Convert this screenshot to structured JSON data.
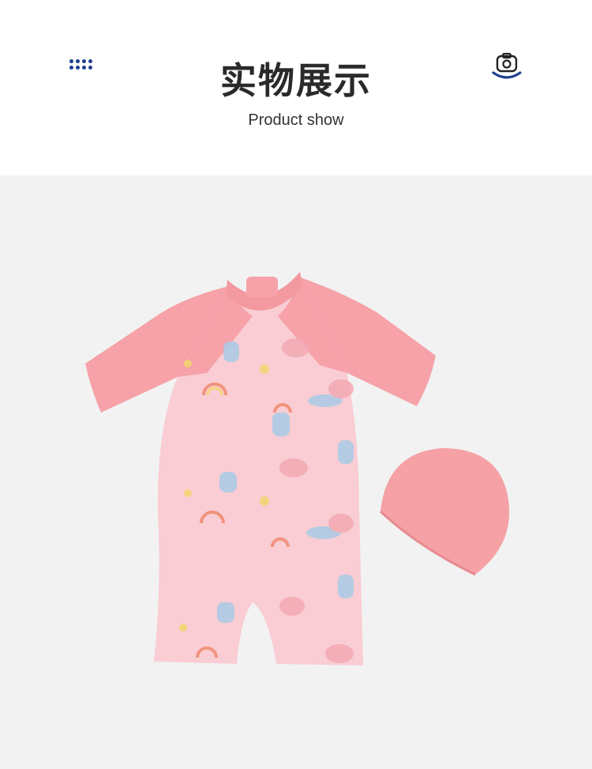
{
  "header": {
    "title": "实物展示",
    "subtitle": "Product show",
    "left_icon": "dots-grid-icon",
    "right_icon": "camera-icon",
    "accent_color": "#1e3f8f"
  },
  "photo": {
    "description_icon": "product-photo",
    "background": "#f2f2f2",
    "swimsuit_color": "#f7a3a8",
    "body_color": "#f9cdd2",
    "cap_color": "#f5a1a5"
  }
}
